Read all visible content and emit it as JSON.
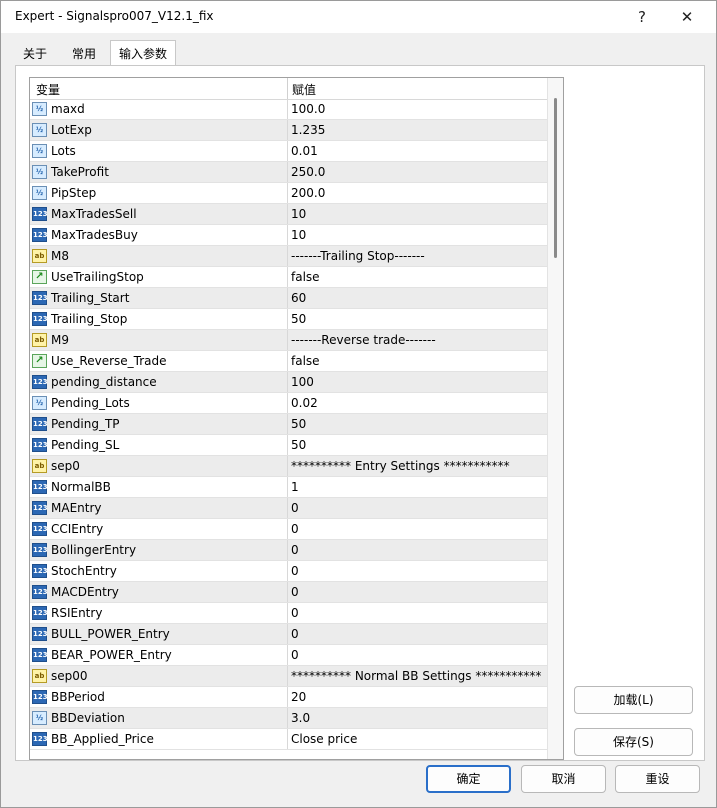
{
  "window": {
    "title": "Expert - Signalspro007_V12.1_fix",
    "help": "?",
    "close": "✕"
  },
  "tabs": [
    {
      "label": "关于"
    },
    {
      "label": "常用"
    },
    {
      "label": "输入参数"
    }
  ],
  "grid": {
    "col_variable": "变量",
    "col_value": "赋值",
    "rows": [
      {
        "icon": "dbl",
        "name": "maxd",
        "value": "100.0"
      },
      {
        "icon": "dbl",
        "name": "LotExp",
        "value": "1.235"
      },
      {
        "icon": "dbl",
        "name": "Lots",
        "value": "0.01"
      },
      {
        "icon": "dbl",
        "name": "TakeProfit",
        "value": "250.0"
      },
      {
        "icon": "dbl",
        "name": "PipStep",
        "value": "200.0"
      },
      {
        "icon": "int",
        "name": "MaxTradesSell",
        "value": "10"
      },
      {
        "icon": "int",
        "name": "MaxTradesBuy",
        "value": "10"
      },
      {
        "icon": "str",
        "name": "M8",
        "value": "-------Trailing Stop-------"
      },
      {
        "icon": "bool",
        "name": "UseTrailingStop",
        "value": "false"
      },
      {
        "icon": "int",
        "name": "Trailing_Start",
        "value": "60"
      },
      {
        "icon": "int",
        "name": "Trailing_Stop",
        "value": "50"
      },
      {
        "icon": "str",
        "name": "M9",
        "value": "-------Reverse trade-------"
      },
      {
        "icon": "bool",
        "name": "Use_Reverse_Trade",
        "value": "false"
      },
      {
        "icon": "int",
        "name": "pending_distance",
        "value": "100"
      },
      {
        "icon": "dbl",
        "name": "Pending_Lots",
        "value": "0.02"
      },
      {
        "icon": "int",
        "name": "Pending_TP",
        "value": "50"
      },
      {
        "icon": "int",
        "name": "Pending_SL",
        "value": "50"
      },
      {
        "icon": "str",
        "name": "sep0",
        "value": "********** Entry Settings ***********"
      },
      {
        "icon": "int",
        "name": "NormalBB",
        "value": "1"
      },
      {
        "icon": "int",
        "name": "MAEntry",
        "value": "0"
      },
      {
        "icon": "int",
        "name": "CCIEntry",
        "value": "0"
      },
      {
        "icon": "int",
        "name": "BollingerEntry",
        "value": "0"
      },
      {
        "icon": "int",
        "name": "StochEntry",
        "value": "0"
      },
      {
        "icon": "int",
        "name": "MACDEntry",
        "value": "0"
      },
      {
        "icon": "int",
        "name": "RSIEntry",
        "value": "0"
      },
      {
        "icon": "int",
        "name": "BULL_POWER_Entry",
        "value": "0"
      },
      {
        "icon": "int",
        "name": "BEAR_POWER_Entry",
        "value": "0"
      },
      {
        "icon": "str",
        "name": "sep00",
        "value": "********** Normal BB Settings ***********"
      },
      {
        "icon": "int",
        "name": "BBPeriod",
        "value": "20"
      },
      {
        "icon": "dbl",
        "name": "BBDeviation",
        "value": "3.0"
      },
      {
        "icon": "int",
        "name": "BB_Applied_Price",
        "value": "Close price"
      }
    ]
  },
  "icon_text": {
    "dbl": "½",
    "int": "123",
    "str": "ab",
    "bool": "↗"
  },
  "side_buttons": {
    "load": "加载(L)",
    "save": "保存(S)"
  },
  "footer_buttons": {
    "ok": "确定",
    "cancel": "取消",
    "reset": "重设"
  }
}
